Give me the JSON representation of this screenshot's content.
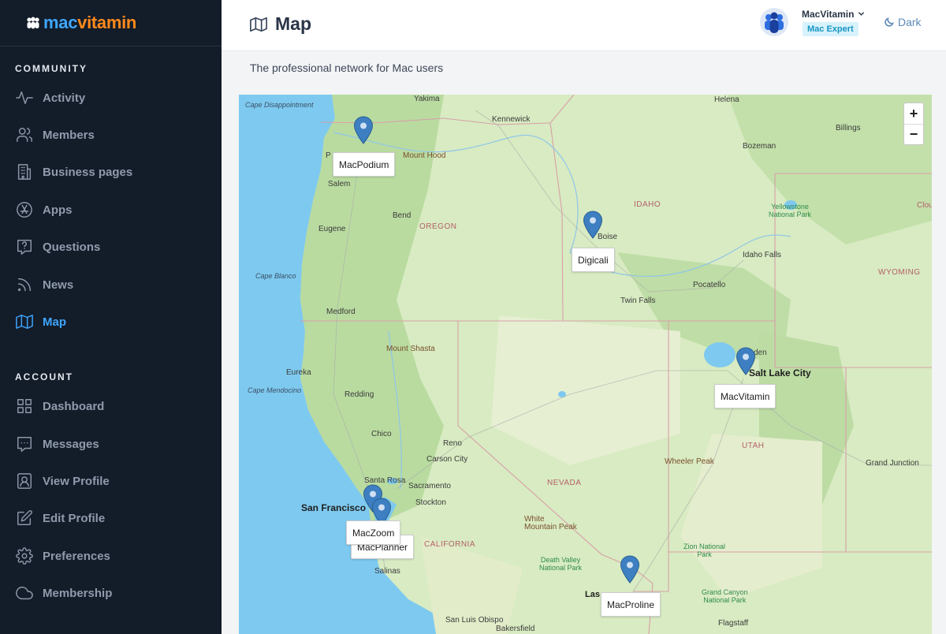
{
  "logo": {
    "part1": "mac",
    "part2": "vitamin"
  },
  "sidebar": {
    "community_label": "COMMUNITY",
    "account_label": "ACCOUNT",
    "community_items": [
      {
        "label": "Activity"
      },
      {
        "label": "Members"
      },
      {
        "label": "Business pages"
      },
      {
        "label": "Apps"
      },
      {
        "label": "Questions"
      },
      {
        "label": "News"
      },
      {
        "label": "Map"
      }
    ],
    "account_items": [
      {
        "label": "Dashboard"
      },
      {
        "label": "Messages"
      },
      {
        "label": "View Profile"
      },
      {
        "label": "Edit Profile"
      },
      {
        "label": "Preferences"
      },
      {
        "label": "Membership"
      }
    ]
  },
  "header": {
    "title": "Map",
    "user_name": "MacVitamin",
    "user_badge": "Mac Expert",
    "theme_toggle": "Dark"
  },
  "subtitle": "The professional network for Mac users",
  "map": {
    "zoom_in": "+",
    "zoom_out": "−",
    "states": {
      "idaho": "IDAHO",
      "oregon": "OREGON",
      "wyoming": "WYOMING",
      "nevada": "NEVADA",
      "utah": "UTAH",
      "california": "CALIFORNIA"
    },
    "cities": {
      "yakima": "Yakima",
      "kennewick": "Kennewick",
      "helena": "Helena",
      "billings": "Billings",
      "bozeman": "Bozeman",
      "salem": "Salem",
      "bend": "Bend",
      "eugene": "Eugene",
      "medford": "Medford",
      "boise": "Boise",
      "idaho_falls": "Idaho Falls",
      "pocatello": "Pocatello",
      "twin_falls": "Twin Falls",
      "eureka": "Eureka",
      "redding": "Redding",
      "chico": "Chico",
      "reno": "Reno",
      "carson_city": "Carson City",
      "santa_rosa": "Santa Rosa",
      "sacramento": "Sacramento",
      "stockton": "Stockton",
      "san_francisco": "San Francisco",
      "salinas": "Salinas",
      "salt_lake_city": "Salt Lake City",
      "ogden": "den",
      "grand_junction": "Grand Junction",
      "las_vegas": "Las",
      "san_luis_obispo": "San Luis Obispo",
      "bakersfield": "Bakersfield",
      "flagstaff": "Flagstaff",
      "cloud": "Clou",
      "portland": "P"
    },
    "peaks": {
      "mount_hood": "Mount Hood",
      "mount_shasta": "Mount Shasta",
      "wheeler_peak": "Wheeler Peak",
      "white_mountain_line1": "White",
      "white_mountain_line2": "Mountain Peak"
    },
    "parks": {
      "yellowstone_1": "Yellowstone",
      "yellowstone_2": "National Park",
      "zion_1": "Zion National",
      "zion_2": "Park",
      "death_valley_1": "Death Valley",
      "death_valley_2": "National Park",
      "grand_canyon_1": "Grand Canyon",
      "grand_canyon_2": "National Park"
    },
    "capes": {
      "disappointment": "Cape Disappointment",
      "blanco": "Cape Blanco",
      "mendocino": "Cape Mendocino"
    },
    "pins": [
      {
        "label": "MacPodium"
      },
      {
        "label": "Digicali"
      },
      {
        "label": "MacVitamin"
      },
      {
        "label": "MacPlanner"
      },
      {
        "label": "MacZoom"
      },
      {
        "label": "MacProline"
      }
    ]
  }
}
